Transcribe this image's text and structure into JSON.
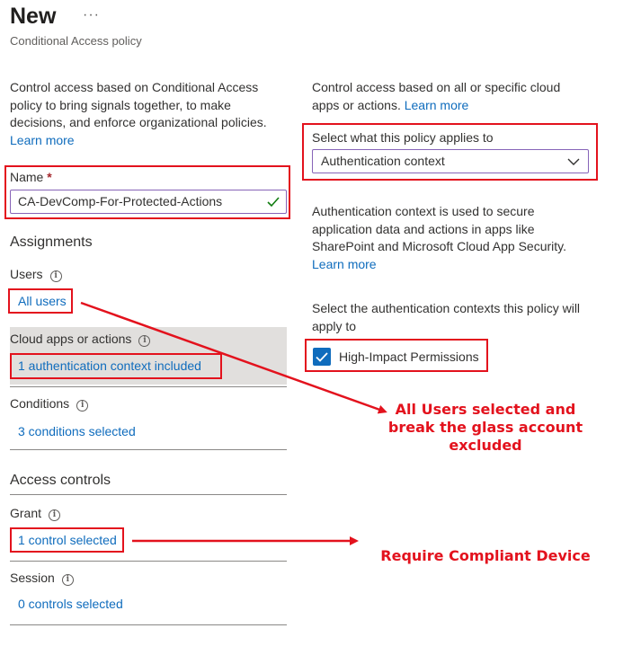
{
  "header": {
    "title": "New",
    "more": "···",
    "subtitle": "Conditional Access policy"
  },
  "left": {
    "intro": "Control access based on Conditional Access policy to bring signals together, to make decisions, and enforce organizational policies.",
    "learn_more": "Learn more",
    "name_label": "Name",
    "required_mark": "*",
    "name_value": "CA-DevComp-For-Protected-Actions",
    "assignments_heading": "Assignments",
    "users_label": "Users",
    "users_value": "All users",
    "cloud_label": "Cloud apps or actions",
    "cloud_value": "1 authentication context included",
    "conditions_label": "Conditions",
    "conditions_value": "3 conditions selected",
    "access_heading": "Access controls",
    "grant_label": "Grant",
    "grant_value": "1 control selected",
    "session_label": "Session",
    "session_value": "0 controls selected"
  },
  "right": {
    "intro": "Control access based on all or specific cloud apps or actions.",
    "learn_more": "Learn more",
    "select_label": "Select what this policy applies to",
    "select_value": "Authentication context",
    "auth_desc": "Authentication context is used to secure application data and actions in apps like SharePoint and Microsoft Cloud App Security.",
    "learn_more2": "Learn more",
    "contexts_label": "Select the authentication contexts this policy will apply to",
    "checkbox_label": "High-Impact Permissions",
    "checkbox_checked": true
  },
  "annotations": {
    "users_note": "All Users selected and break the glass account excluded",
    "grant_note": "Require Compliant Device"
  },
  "colors": {
    "accent": "#0f6cbd",
    "annotation": "#e3121d",
    "valid_check": "#107c10"
  }
}
